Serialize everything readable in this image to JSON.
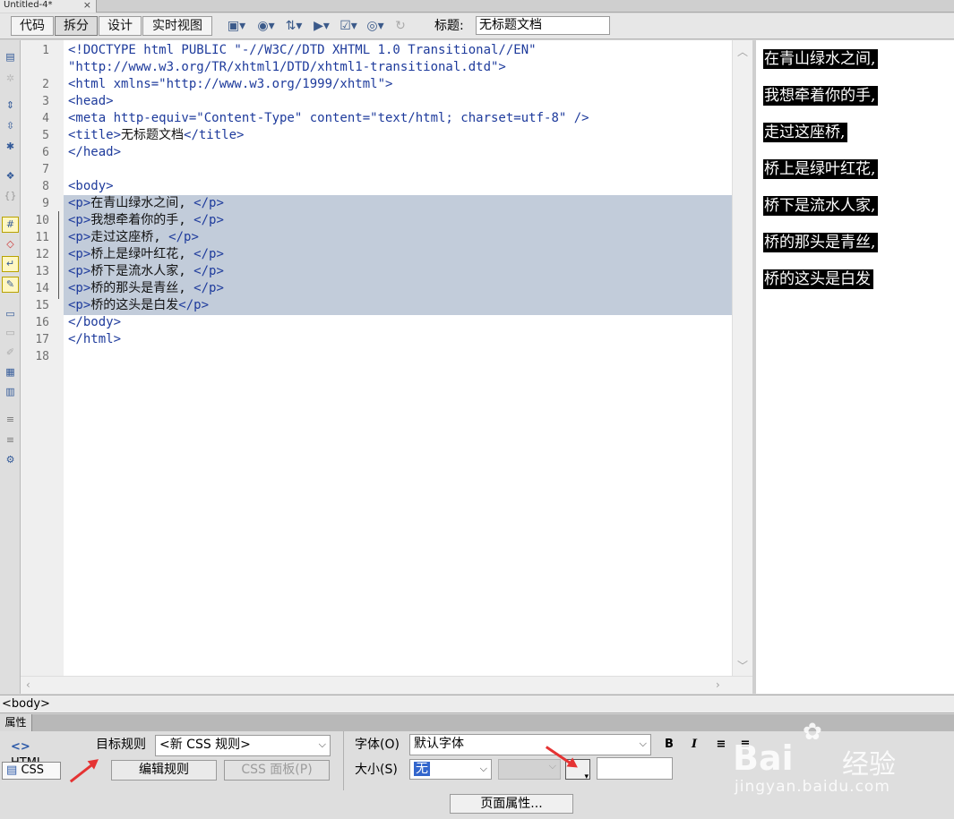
{
  "document": {
    "tab_title": "Untitled-4*",
    "close_glyph": "×"
  },
  "toolbar": {
    "views": [
      "代码",
      "拆分",
      "设计",
      "实时视图"
    ],
    "active_view": "拆分",
    "title_label": "标题:",
    "title_value": "无标题文档",
    "icons": [
      "multiscreen-icon",
      "browser-preview-icon",
      "file-manage-icon",
      "validate-icon",
      "check-compat-icon",
      "visual-aids-icon",
      "refresh-icon"
    ]
  },
  "code": {
    "lines": [
      {
        "n": "1",
        "text": "<!DOCTYPE html PUBLIC \"-//W3C//DTD XHTML 1.0 Transitional//EN\""
      },
      {
        "n": "",
        "text": "\"http://www.w3.org/TR/xhtml1/DTD/xhtml1-transitional.dtd\">"
      },
      {
        "n": "2",
        "text": "<html xmlns=\"http://www.w3.org/1999/xhtml\">"
      },
      {
        "n": "3",
        "text": "<head>"
      },
      {
        "n": "4",
        "text": "<meta http-equiv=\"Content-Type\" content=\"text/html; charset=utf-8\" />"
      },
      {
        "n": "5",
        "text": "<title>无标题文档</title>"
      },
      {
        "n": "6",
        "text": "</head>"
      },
      {
        "n": "7",
        "text": ""
      },
      {
        "n": "8",
        "text": "<body>"
      },
      {
        "n": "9",
        "text": "<p>在青山绿水之间, </p>"
      },
      {
        "n": "10",
        "text": "<p>我想牵着你的手, </p>"
      },
      {
        "n": "11",
        "text": "<p>走过这座桥, </p>"
      },
      {
        "n": "12",
        "text": "<p>桥上是绿叶红花, </p>"
      },
      {
        "n": "13",
        "text": "<p>桥下是流水人家, </p>"
      },
      {
        "n": "14",
        "text": "<p>桥的那头是青丝, </p>"
      },
      {
        "n": "15",
        "text": "<p>桥的这头是白发</p>"
      },
      {
        "n": "16",
        "text": "</body>"
      },
      {
        "n": "17",
        "text": "</html>"
      },
      {
        "n": "18",
        "text": ""
      }
    ],
    "selected_lines": "9-15"
  },
  "preview": {
    "paragraphs": [
      "在青山绿水之间,",
      "我想牵着你的手,",
      "走过这座桥,",
      "桥上是绿叶红花,",
      "桥下是流水人家,",
      "桥的那头是青丝,",
      "桥的这头是白发"
    ]
  },
  "status_bar": {
    "tag_selector": "<body>"
  },
  "properties": {
    "panel_title": "属性",
    "mode_html": "HTML",
    "mode_css": "CSS",
    "target_rule_label": "目标规则",
    "target_rule_value": "<新 CSS 规则>",
    "edit_rule_button": "编辑规则",
    "css_panel_button": "CSS 面板(P)",
    "font_label": "字体(O)",
    "font_value": "默认字体",
    "size_label": "大小(S)",
    "size_value": "无",
    "bold": "B",
    "italic": "I",
    "page_props_button": "页面属性...",
    "color_value": ""
  },
  "watermark": {
    "text": "Bai",
    "text2": "经验",
    "url": "jingyan.baidu.com"
  },
  "colors": {
    "selection": "#c2ccda",
    "tag": "#1e3b9c",
    "annotation_arrow": "#e53333"
  }
}
